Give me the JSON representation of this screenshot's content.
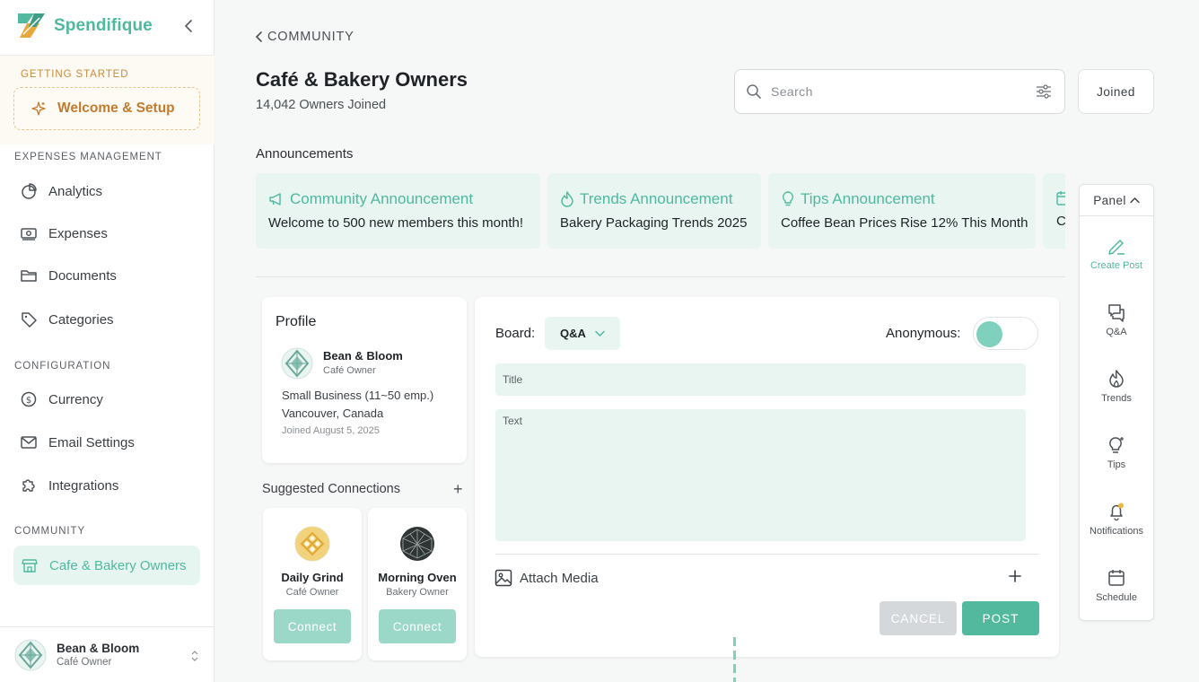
{
  "sidebar": {
    "brand": "Spendifique",
    "sections": {
      "getting_started": "GETTING STARTED",
      "expenses": "EXPENSES MANAGEMENT",
      "configuration": "CONFIGURATION",
      "community": "COMMUNITY"
    },
    "welcome": "Welcome & Setup",
    "expense_items": [
      "Analytics",
      "Expenses",
      "Documents",
      "Categories"
    ],
    "config_items": [
      "Currency",
      "Email Settings",
      "Integrations"
    ],
    "community_item": "Cafe & Bakery Owners",
    "user": {
      "name": "Bean & Bloom",
      "role": "Café Owner"
    }
  },
  "header": {
    "breadcrumb": "COMMUNITY",
    "title": "Café & Bakery Owners",
    "subtitle": "14,042 Owners Joined",
    "search_placeholder": "Search",
    "joined_label": "Joined"
  },
  "announcements": {
    "heading": "Announcements",
    "items": [
      {
        "title": "Community Announcement",
        "text": "Welcome to 500 new members this month!",
        "icon": "megaphone-icon"
      },
      {
        "title": "Trends Announcement",
        "text": "Bakery Packaging Trends 2025",
        "icon": "flame-icon"
      },
      {
        "title": "Tips Announcement",
        "text": "Coffee Bean Prices Rise 12% This Month",
        "icon": "lightbulb-icon"
      },
      {
        "title": "",
        "text": "C",
        "icon": "calendar-icon"
      }
    ]
  },
  "profile": {
    "heading": "Profile",
    "name": "Bean & Bloom",
    "role": "Café Owner",
    "size": "Small Business (11~50 emp.)",
    "location": "Vancouver, Canada",
    "joined": "Joined August 5, 2025"
  },
  "suggestions": {
    "heading": "Suggested Connections",
    "plus": "+",
    "items": [
      {
        "name": "Daily Grind",
        "role": "Café Owner",
        "button": "Connect"
      },
      {
        "name": "Morning Oven",
        "role": "Bakery Owner",
        "button": "Connect"
      }
    ]
  },
  "post_form": {
    "board_label": "Board:",
    "board_value": "Q&A",
    "anonymous_label": "Anonymous:",
    "anonymous_on": false,
    "title_placeholder": "Title",
    "text_placeholder": "Text",
    "attach_label": "Attach Media",
    "cancel_label": "CANCEL",
    "post_label": "POST"
  },
  "panel": {
    "heading": "Panel",
    "items": [
      {
        "label": "Create Post",
        "icon": "pencil-icon"
      },
      {
        "label": "Q&A",
        "icon": "chat-bubbles-icon"
      },
      {
        "label": "Trends",
        "icon": "flame-icon"
      },
      {
        "label": "Tips",
        "icon": "lightbulb-icon"
      },
      {
        "label": "Notifications",
        "icon": "bell-icon"
      },
      {
        "label": "Schedule",
        "icon": "calendar-icon"
      }
    ]
  },
  "colors": {
    "accent": "#4fb9a0",
    "accent_light": "#e8f5f1",
    "warning": "#c98a3d",
    "connect_button": "#9bd8c8",
    "post_button": "#52b89e"
  }
}
